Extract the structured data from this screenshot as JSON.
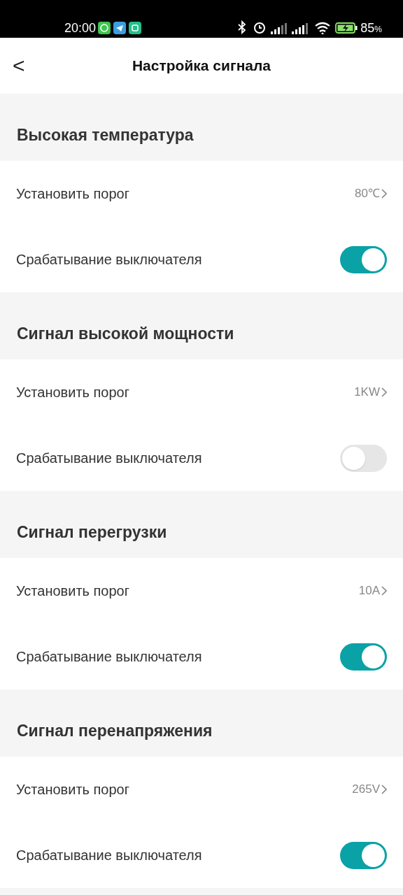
{
  "status_bar": {
    "time": "20:00",
    "battery": "85",
    "battery_unit": "%"
  },
  "header": {
    "back": "<",
    "title": "Настройка сигнала"
  },
  "sections": [
    {
      "title": "Высокая температура",
      "threshold_label": "Установить порог",
      "threshold_value": "80℃",
      "trip_label": "Срабатывание выключателя",
      "trip_on": true
    },
    {
      "title": "Сигнал высокой мощности",
      "threshold_label": "Установить порог",
      "threshold_value": "1KW",
      "trip_label": "Срабатывание выключателя",
      "trip_on": false
    },
    {
      "title": "Сигнал перегрузки",
      "threshold_label": "Установить порог",
      "threshold_value": "10A",
      "trip_label": "Срабатывание выключателя",
      "trip_on": true
    },
    {
      "title": "Сигнал перенапряжения",
      "threshold_label": "Установить порог",
      "threshold_value": "265V",
      "trip_label": "Срабатывание выключателя",
      "trip_on": true
    }
  ]
}
